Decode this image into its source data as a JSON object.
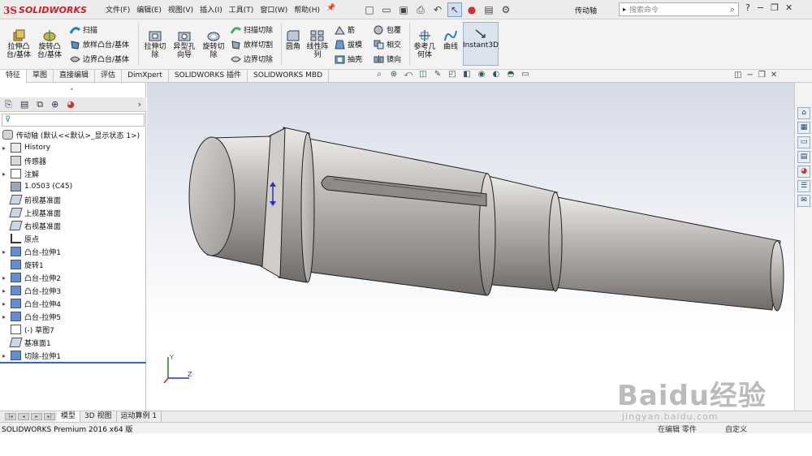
{
  "titlebar": {
    "app_logo": "SOLIDWORKS",
    "menu": [
      "文件(F)",
      "编辑(E)",
      "视图(V)",
      "插入(I)",
      "工具(T)",
      "窗口(W)",
      "帮助(H)"
    ],
    "document_name": "传动轴",
    "search_placeholder": "搜索命令",
    "help_label": "?"
  },
  "ribbon": {
    "big_buttons": [
      {
        "label": "拉伸凸台/基体",
        "icon": "extruded-boss-icon"
      },
      {
        "label": "旋转凸台/基体",
        "icon": "revolved-boss-icon"
      },
      {
        "label": "拉伸切除",
        "icon": "extruded-cut-icon"
      },
      {
        "label": "异型孔向导",
        "icon": "hole-wizard-icon"
      },
      {
        "label": "旋转切除",
        "icon": "revolved-cut-icon"
      },
      {
        "label": "圆角",
        "icon": "fillet-icon"
      },
      {
        "label": "线性阵列",
        "icon": "linear-pattern-icon"
      },
      {
        "label": "参考几何体",
        "icon": "reference-geometry-icon"
      },
      {
        "label": "曲线",
        "icon": "curves-icon"
      },
      {
        "label": "Instant3D",
        "icon": "instant3d-icon"
      }
    ],
    "small_buttons": [
      {
        "label": "扫描",
        "icon": "swept-boss-icon"
      },
      {
        "label": "放样凸台/基体",
        "icon": "lofted-boss-icon"
      },
      {
        "label": "边界凸台/基体",
        "icon": "boundary-boss-icon"
      },
      {
        "label": "扫描切除",
        "icon": "swept-cut-icon"
      },
      {
        "label": "放样切割",
        "icon": "lofted-cut-icon"
      },
      {
        "label": "边界切除",
        "icon": "boundary-cut-icon"
      },
      {
        "label": "筋",
        "icon": "rib-icon"
      },
      {
        "label": "拔模",
        "icon": "draft-icon"
      },
      {
        "label": "抽壳",
        "icon": "shell-icon"
      },
      {
        "label": "包覆",
        "icon": "wrap-icon"
      },
      {
        "label": "相交",
        "icon": "intersect-icon"
      },
      {
        "label": "镜向",
        "icon": "mirror-icon"
      }
    ]
  },
  "command_tabs": [
    "特征",
    "草图",
    "直接编辑",
    "评估",
    "DimXpert",
    "SOLIDWORKS 插件",
    "SOLIDWORKS MBD"
  ],
  "feature_tree": {
    "root": "传动轴  (默认<<默认>_显示状态 1>)",
    "items": [
      {
        "label": "History",
        "expand": true
      },
      {
        "label": "传感器",
        "expand": false
      },
      {
        "label": "注解",
        "expand": true
      },
      {
        "label": "1.0503 (C45)",
        "expand": false
      },
      {
        "label": "前视基准面",
        "expand": false
      },
      {
        "label": "上视基准面",
        "expand": false
      },
      {
        "label": "右视基准面",
        "expand": false
      },
      {
        "label": "原点",
        "expand": false
      },
      {
        "label": "凸台-拉伸1",
        "expand": true
      },
      {
        "label": "旋转1",
        "expand": false
      },
      {
        "label": "凸台-拉伸2",
        "expand": true
      },
      {
        "label": "凸台-拉伸3",
        "expand": true
      },
      {
        "label": "凸台-拉伸4",
        "expand": true
      },
      {
        "label": "凸台-拉伸5",
        "expand": true
      },
      {
        "label": "(-) 草图7",
        "expand": false
      },
      {
        "label": "基准面1",
        "expand": false
      },
      {
        "label": "切除-拉伸1",
        "expand": true
      }
    ]
  },
  "bottom_tabs": [
    "模型",
    "3D 视图",
    "运动算例 1"
  ],
  "status": {
    "left": "SOLIDWORKS Premium 2016 x64 版",
    "middle": "在编辑 零件",
    "right": "自定义"
  },
  "watermark": {
    "brand": "Baidu经验",
    "url": "jingyan.baidu.com"
  },
  "colors": {
    "logo_red": "#d01e28",
    "shaft_gray": "#a9a6a4",
    "tree_blue": "#2b6fb7"
  }
}
